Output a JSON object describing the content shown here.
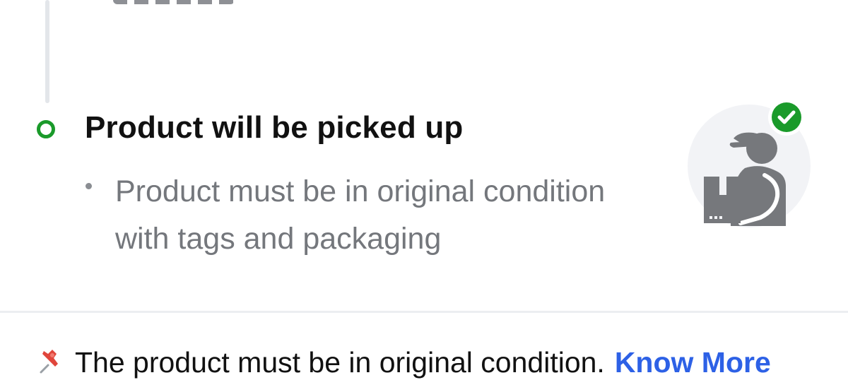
{
  "step": {
    "title": "Product will be picked up",
    "bullet": "Product must be in original condition with tags and packaging",
    "status_color": "#1a9a2a"
  },
  "illustration": {
    "icon": "delivery-person-with-box-icon",
    "badge_icon": "check-circle-icon",
    "badge_color": "#1a9a2a"
  },
  "note": {
    "icon": "pushpin-icon",
    "text": "The product must be in original condition.",
    "link_label": "Know More",
    "link_color": "#2d61e6"
  }
}
